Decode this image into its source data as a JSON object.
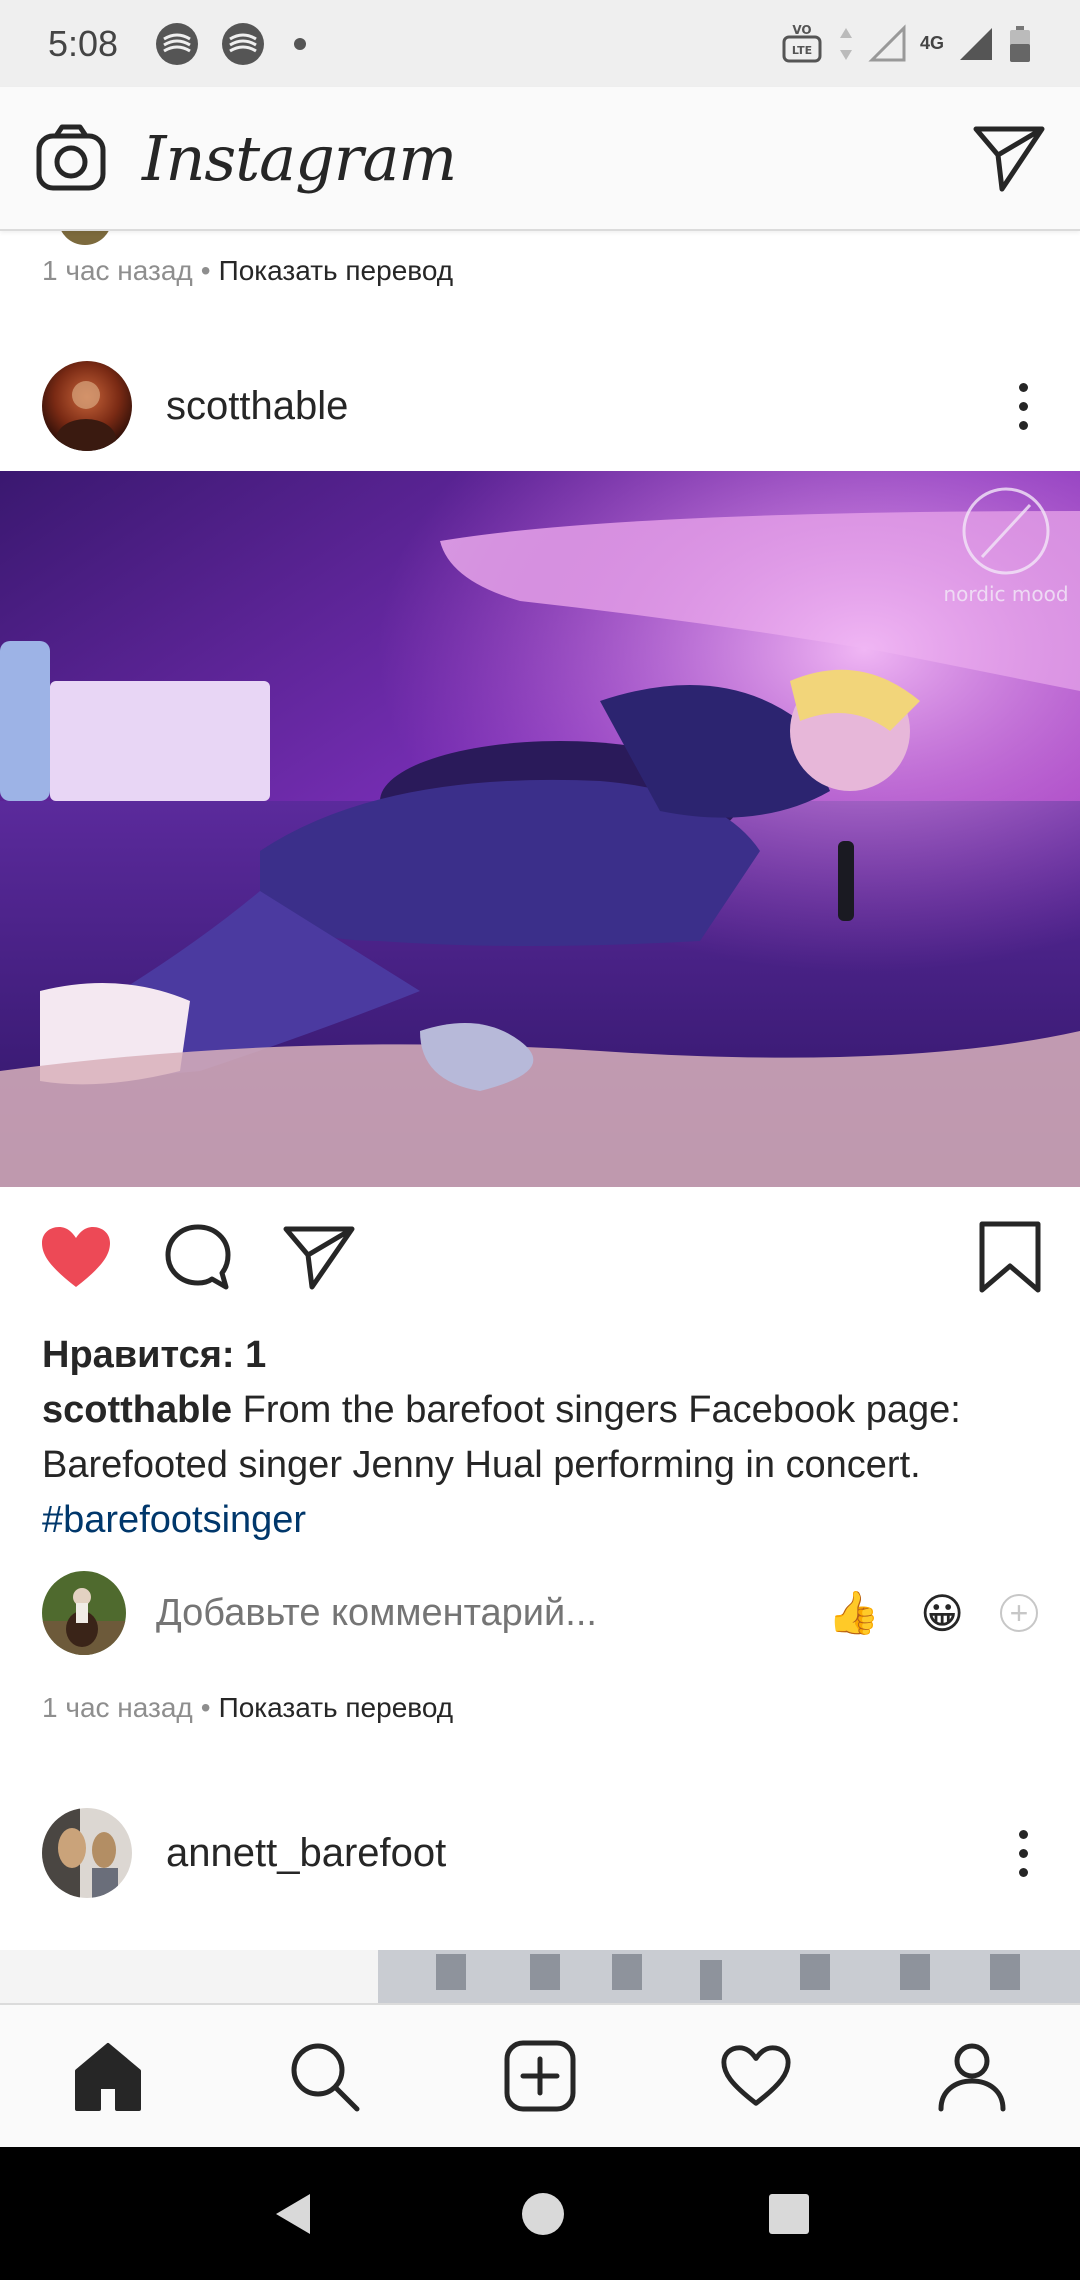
{
  "status_bar": {
    "time": "5:08",
    "network": "4G",
    "volte": "VoLTE"
  },
  "app": {
    "logo_text": "Instagram"
  },
  "feed": {
    "previous_post_meta": {
      "time": "1 час назад",
      "separator": "•",
      "translate": "Показать перевод"
    },
    "post": {
      "username": "scotthable",
      "image_watermark": "nordic mood",
      "likes": "Нравится: 1",
      "caption_user": "scotthable",
      "caption_text": "From the barefoot singers Facebook page: Barefooted singer Jenny Hual performing in concert.",
      "hashtag": "#barefootsinger",
      "comment_placeholder": "Добавьте комментарий...",
      "quick_emojis": [
        "👍",
        "😀"
      ],
      "time": "1 час назад",
      "separator": "•",
      "translate": "Показать перевод",
      "liked": true
    },
    "next_post": {
      "username": "annett_barefoot"
    }
  },
  "colors": {
    "like_red": "#ed4956",
    "hashtag_blue": "#00376b",
    "meta_grey": "#8e8e8e"
  },
  "bottom_nav": {
    "items": [
      "home-icon",
      "search-icon",
      "new-post-icon",
      "activity-icon",
      "profile-icon"
    ],
    "active": "home-icon"
  }
}
